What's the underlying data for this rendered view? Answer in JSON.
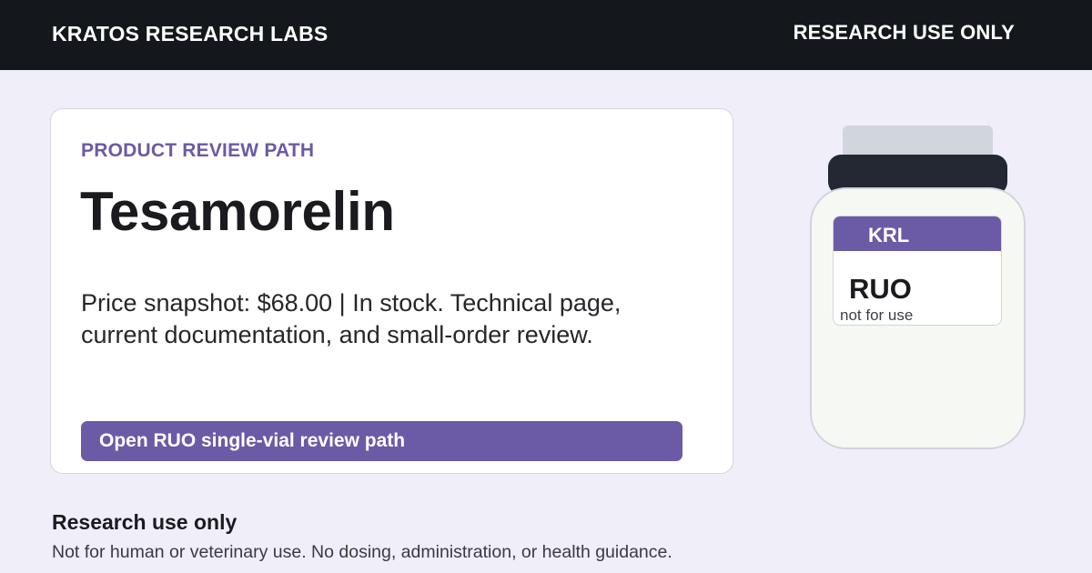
{
  "header": {
    "brand": "KRATOS RESEARCH LABS",
    "notice": "RESEARCH USE ONLY"
  },
  "card": {
    "eyebrow": "PRODUCT REVIEW PATH",
    "title": "Tesamorelin",
    "snapshot": "Price snapshot: $68.00 | In stock. Technical page, current documentation, and small-order review.",
    "cta_label": "Open RUO single-vial review path"
  },
  "vial": {
    "label_brand": "KRL",
    "label_main": "RUO",
    "label_note": "not for use"
  },
  "disclaimer": {
    "title": "Research use only",
    "text": "Not for human or veterinary use. No dosing, administration, or health guidance."
  },
  "colors": {
    "header_bg": "#14181c",
    "accent": "#6b5aa6",
    "page_bg": "#f0eef9",
    "vial_cap": "#232833"
  }
}
